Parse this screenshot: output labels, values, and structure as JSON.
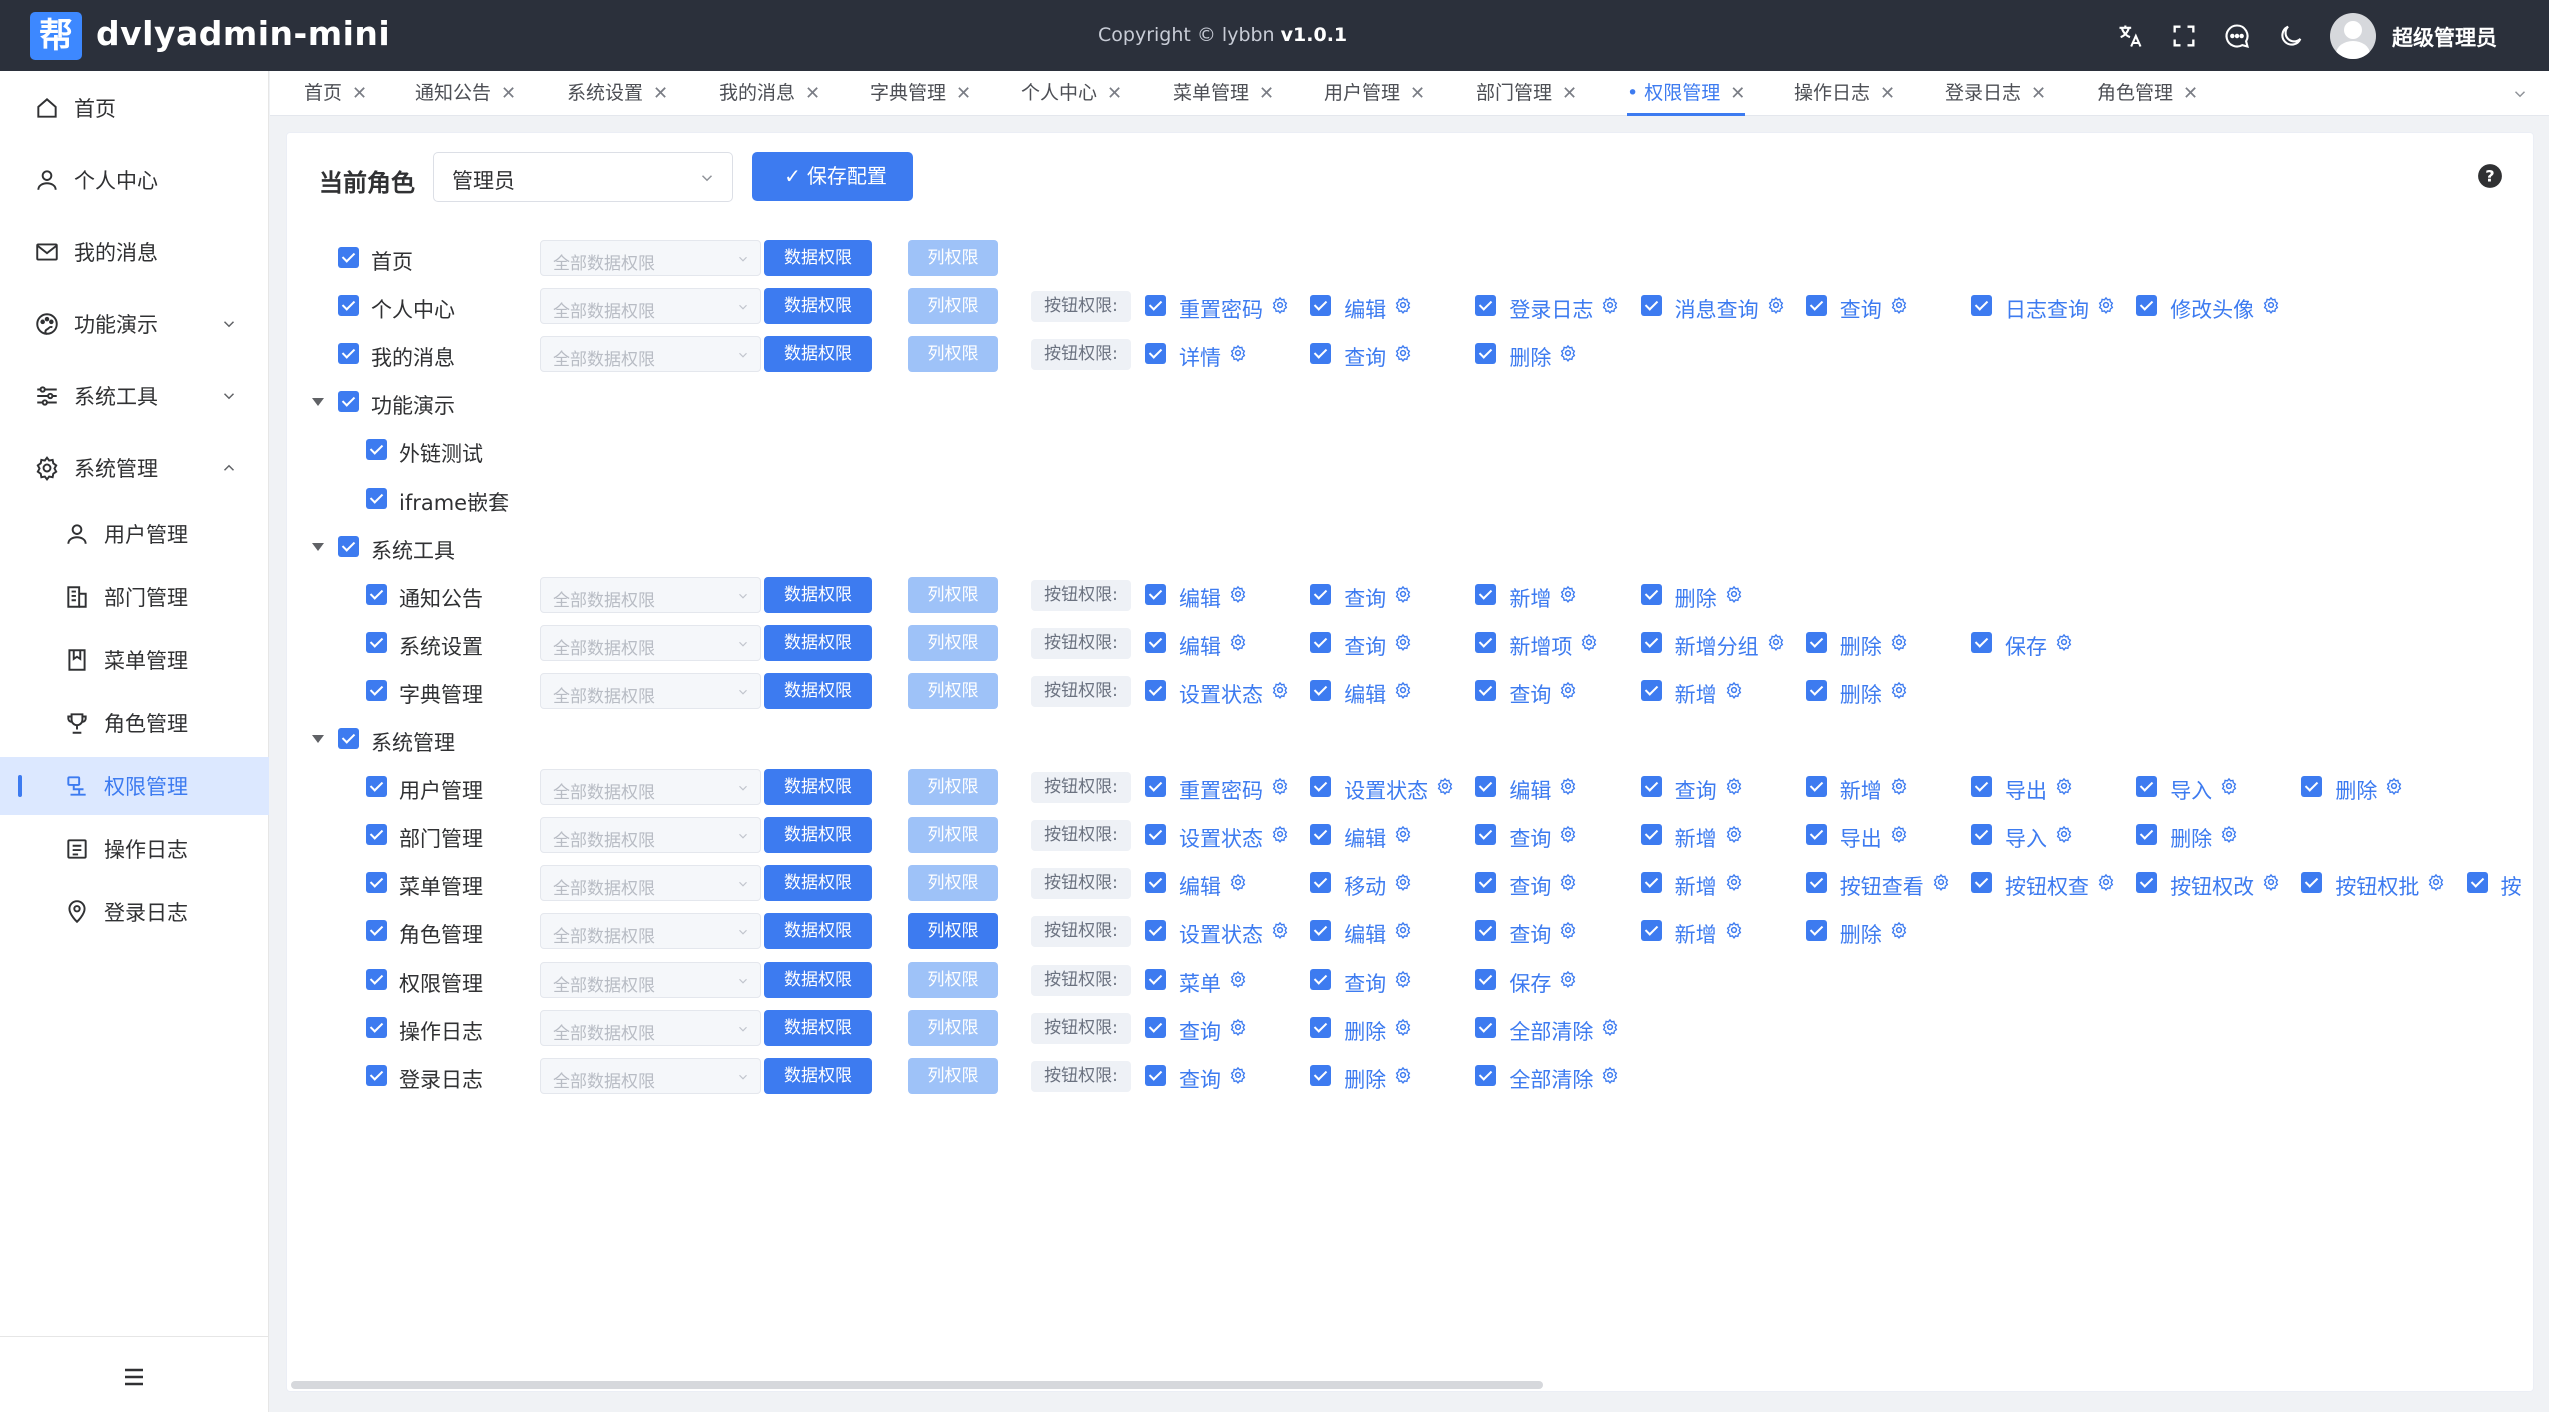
{
  "header": {
    "logo_char": "帮",
    "app_name": "dvlyadmin-mini",
    "copyright_text": "Copyright © lybbn",
    "version": "v1.0.1",
    "user_name": "超级管理员",
    "icons": [
      "translate-icon",
      "fullscreen-icon",
      "message-icon",
      "dark-mode-icon"
    ]
  },
  "sidebar": {
    "items": [
      {
        "label": "首页",
        "icon": "home-icon"
      },
      {
        "label": "个人中心",
        "icon": "user-icon"
      },
      {
        "label": "我的消息",
        "icon": "mail-icon"
      },
      {
        "label": "功能演示",
        "icon": "palette-icon",
        "expandable": true
      },
      {
        "label": "系统工具",
        "icon": "sliders-icon",
        "expandable": true
      },
      {
        "label": "系统管理",
        "icon": "gear-icon",
        "expandable": true,
        "expanded": true
      }
    ],
    "sub_items": [
      {
        "label": "用户管理",
        "icon": "user-icon"
      },
      {
        "label": "部门管理",
        "icon": "building-icon"
      },
      {
        "label": "菜单管理",
        "icon": "bookmark-icon"
      },
      {
        "label": "角色管理",
        "icon": "trophy-icon"
      },
      {
        "label": "权限管理",
        "icon": "permission-icon",
        "active": true
      },
      {
        "label": "操作日志",
        "icon": "log-icon"
      },
      {
        "label": "登录日志",
        "icon": "location-icon"
      }
    ]
  },
  "tabs": [
    {
      "label": "首页"
    },
    {
      "label": "通知公告"
    },
    {
      "label": "系统设置"
    },
    {
      "label": "我的消息"
    },
    {
      "label": "字典管理"
    },
    {
      "label": "个人中心"
    },
    {
      "label": "菜单管理"
    },
    {
      "label": "用户管理"
    },
    {
      "label": "部门管理"
    },
    {
      "label": "权限管理",
      "active": true
    },
    {
      "label": "操作日志"
    },
    {
      "label": "登录日志"
    },
    {
      "label": "角色管理"
    }
  ],
  "toolbar": {
    "role_label": "当前角色",
    "role_value": "管理员",
    "save_label": "保存配置"
  },
  "labels": {
    "scope_select": "全部数据权限",
    "data_perm": "数据权限",
    "column_perm": "列权限",
    "button_perm": "按钮权限:"
  },
  "tree": [
    {
      "label": "首页",
      "level": 1,
      "controls": true,
      "perms": []
    },
    {
      "label": "个人中心",
      "level": 1,
      "controls": true,
      "perms": [
        "重置密码",
        "编辑",
        "登录日志",
        "消息查询",
        "查询",
        "日志查询",
        "修改头像"
      ]
    },
    {
      "label": "我的消息",
      "level": 1,
      "controls": true,
      "perms": [
        "详情",
        "查询",
        "删除"
      ]
    },
    {
      "label": "功能演示",
      "level": 1,
      "group": true,
      "controls": false,
      "perms": []
    },
    {
      "label": "外链测试",
      "level": 2,
      "controls": false,
      "perms": []
    },
    {
      "label": "iframe嵌套",
      "level": 2,
      "controls": false,
      "perms": []
    },
    {
      "label": "系统工具",
      "level": 1,
      "group": true,
      "controls": false,
      "perms": []
    },
    {
      "label": "通知公告",
      "level": 2,
      "controls": true,
      "perms": [
        "编辑",
        "查询",
        "新增",
        "删除"
      ]
    },
    {
      "label": "系统设置",
      "level": 2,
      "controls": true,
      "perms": [
        "编辑",
        "查询",
        "新增项",
        "新增分组",
        "删除",
        "保存"
      ]
    },
    {
      "label": "字典管理",
      "level": 2,
      "controls": true,
      "perms": [
        "设置状态",
        "编辑",
        "查询",
        "新增",
        "删除"
      ]
    },
    {
      "label": "系统管理",
      "level": 1,
      "group": true,
      "controls": false,
      "perms": []
    },
    {
      "label": "用户管理",
      "level": 2,
      "controls": true,
      "perms": [
        "重置密码",
        "设置状态",
        "编辑",
        "查询",
        "新增",
        "导出",
        "导入",
        "删除"
      ]
    },
    {
      "label": "部门管理",
      "level": 2,
      "controls": true,
      "perms": [
        "设置状态",
        "编辑",
        "查询",
        "新增",
        "导出",
        "导入",
        "删除"
      ]
    },
    {
      "label": "菜单管理",
      "level": 2,
      "controls": true,
      "perms": [
        "编辑",
        "移动",
        "查询",
        "新增",
        "按钮查看",
        "按钮权查",
        "按钮权改",
        "按钮权批",
        "按"
      ]
    },
    {
      "label": "角色管理",
      "level": 2,
      "controls": true,
      "col_active": true,
      "perms": [
        "设置状态",
        "编辑",
        "查询",
        "新增",
        "删除"
      ]
    },
    {
      "label": "权限管理",
      "level": 2,
      "controls": true,
      "perms": [
        "菜单",
        "查询",
        "保存"
      ]
    },
    {
      "label": "操作日志",
      "level": 2,
      "controls": true,
      "perms": [
        "查询",
        "删除",
        "全部清除"
      ]
    },
    {
      "label": "登录日志",
      "level": 2,
      "controls": true,
      "perms": [
        "查询",
        "删除",
        "全部清除"
      ]
    }
  ]
}
